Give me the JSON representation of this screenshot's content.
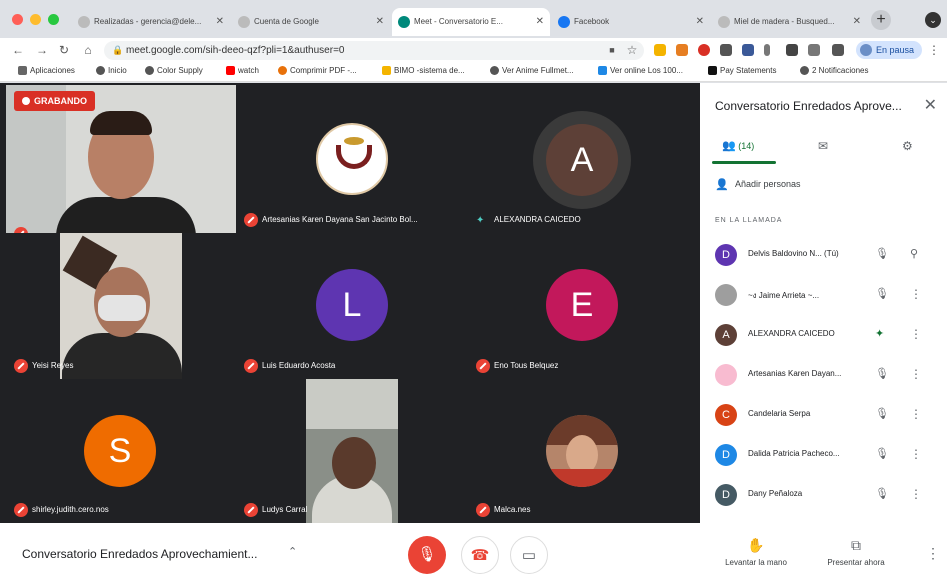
{
  "browser": {
    "tabs": [
      {
        "label": "Realizadas - gerencia@dele...",
        "active": false
      },
      {
        "label": "Cuenta de Google",
        "active": false
      },
      {
        "label": "Meet - Conversatorio E...",
        "active": true
      },
      {
        "label": "Facebook",
        "active": false
      },
      {
        "label": "Miel de madera - Busqued...",
        "active": false
      }
    ],
    "url": "meet.google.com/sih-deeo-qzf?pli=1&authuser=0",
    "profile_label": "En pausa",
    "bookmarks": [
      "Aplicaciones",
      "Inicio",
      "Color Supply",
      "watch",
      "Comprimir PDF -...",
      "BIMO -sistema de...",
      "Ver Anime Fullmet...",
      "Ver online Los 100...",
      "Pay Statements",
      "2 Notificaciones"
    ]
  },
  "meet": {
    "recording_label": "GRABANDO",
    "tiles": [
      {
        "name": "",
        "kind": "video"
      },
      {
        "name": "Artesanias Karen Dayana San Jacinto Bol...",
        "kind": "logo"
      },
      {
        "name": "ALEXANDRA CAICEDO",
        "kind": "avatar",
        "letter": "A"
      },
      {
        "name": "Yeisi Reyes",
        "kind": "video"
      },
      {
        "name": "Luis Eduardo Acosta",
        "kind": "avatar",
        "letter": "L"
      },
      {
        "name": "Eno Tous Belquez",
        "kind": "avatar",
        "letter": "E"
      },
      {
        "name": "shirley.judith.cero.nos",
        "kind": "avatar",
        "letter": "S"
      },
      {
        "name": "Ludys Carral",
        "kind": "video"
      },
      {
        "name": "Malca.nes",
        "kind": "photo"
      }
    ],
    "colors": {
      "avatar_a": "#5d4037",
      "avatar_l": "#5e35b1",
      "avatar_e": "#c2185b",
      "avatar_s": "#ef6c00",
      "recording": "#d93025",
      "muted": "#ea4335"
    }
  },
  "panel": {
    "title": "Conversatorio Enredados Aprove...",
    "people_count": "(14)",
    "add_people_label": "Añadir personas",
    "in_call_label": "EN LA LLAMADA",
    "participants": [
      {
        "letter": "D",
        "name": "Delvis Baldovino N...",
        "suffix": "(Tú)",
        "color": "#5e35b1"
      },
      {
        "letter": "",
        "name": "~ง Jaime Arrieta ~...",
        "suffix": "",
        "color": "#9e9e9e"
      },
      {
        "letter": "A",
        "name": "ALEXANDRA CAICEDO",
        "suffix": "",
        "color": "#5d4037"
      },
      {
        "letter": "",
        "name": "Artesanias Karen Dayan...",
        "suffix": "",
        "color": "#f8bbd0"
      },
      {
        "letter": "C",
        "name": "Candelaria Serpa",
        "suffix": "",
        "color": "#d84315"
      },
      {
        "letter": "D",
        "name": "Dalida Patricia Pacheco...",
        "suffix": "",
        "color": "#1e88e5"
      },
      {
        "letter": "D",
        "name": "Dany Peñaloza",
        "suffix": "",
        "color": "#455a64"
      }
    ]
  },
  "bottom": {
    "meeting_name": "Conversatorio Enredados Aprovechamient...",
    "raise_hand_label": "Levantar la mano",
    "present_label": "Presentar ahora"
  }
}
